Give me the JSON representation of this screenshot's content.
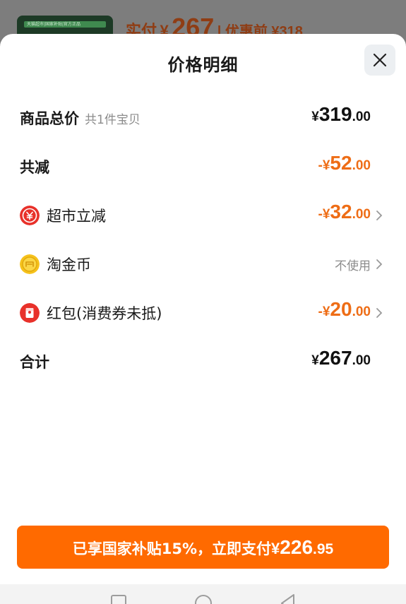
{
  "background": {
    "thumb_caption": "天猫超市|国家补贴|官方正品",
    "paid_label": "实付",
    "paid_symbol": "¥",
    "paid_amount": "267",
    "orig_text": "| 优惠前 ¥318"
  },
  "sheet": {
    "title": "价格明细",
    "rows": {
      "total": {
        "label": "商品总价",
        "sub": "共1件宝贝",
        "symbol": "¥",
        "int": "319",
        "dec": ".00"
      },
      "discount": {
        "label": "共减",
        "symbol": "-¥",
        "int": "52",
        "dec": ".00"
      },
      "supermarket": {
        "label": "超市立减",
        "icon": "supermarket-coin-icon",
        "symbol": "-¥",
        "int": "32",
        "dec": ".00"
      },
      "taojinbi": {
        "label": "淘金币",
        "icon": "gold-coin-icon",
        "value": "不使用"
      },
      "redpacket": {
        "label": "红包(消费券未抵)",
        "icon": "red-packet-icon",
        "symbol": "-¥",
        "int": "20",
        "dec": ".00"
      },
      "sum": {
        "label": "合计",
        "symbol": "¥",
        "int": "267",
        "dec": ".00"
      }
    }
  },
  "pay_button": {
    "text": "已享国家补贴15%，立即支付",
    "symbol": "¥",
    "int": "226",
    "dec": ".95"
  },
  "colors": {
    "accent": "#ff6a00",
    "discount": "#ee6d16",
    "muted": "#8c8c8c"
  }
}
